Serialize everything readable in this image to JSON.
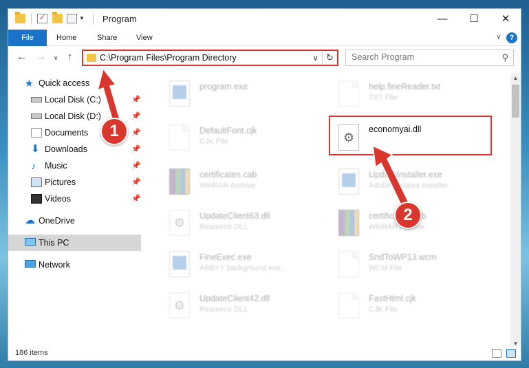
{
  "window": {
    "title": "Program",
    "minimize_glyph": "—",
    "maximize_glyph": "☐",
    "close_glyph": "✕"
  },
  "ribbon": {
    "tabs": [
      {
        "label": "File"
      },
      {
        "label": "Home"
      },
      {
        "label": "Share"
      },
      {
        "label": "View"
      }
    ],
    "help_glyph": "?"
  },
  "navigation": {
    "address_path": "C:\\Program Files\\Program Directory",
    "search_placeholder": "Search Program"
  },
  "sidebar": {
    "items": [
      {
        "label": "Quick access",
        "icon": "star-icon"
      },
      {
        "label": "Local Disk (C:)",
        "icon": "drive-icon",
        "pinned": true
      },
      {
        "label": "Local Disk (D:)",
        "icon": "drive-icon",
        "pinned": true
      },
      {
        "label": "Documents",
        "icon": "documents-icon",
        "pinned": true
      },
      {
        "label": "Downloads",
        "icon": "downloads-icon",
        "pinned": true
      },
      {
        "label": "Music",
        "icon": "music-icon",
        "pinned": true
      },
      {
        "label": "Pictures",
        "icon": "pictures-icon",
        "pinned": true
      },
      {
        "label": "Videos",
        "icon": "videos-icon",
        "pinned": true
      },
      {
        "label": "OneDrive",
        "icon": "onedrive-icon"
      },
      {
        "label": "This PC",
        "icon": "this-pc-icon",
        "selected": true
      },
      {
        "label": "Network",
        "icon": "network-icon"
      }
    ]
  },
  "files": [
    {
      "name": "program.exe",
      "type": "",
      "icon": "exe-icon"
    },
    {
      "name": "help.fineReader.txt",
      "type": "TXT File",
      "icon": "document-icon"
    },
    {
      "name": "DefaultFont.cjk",
      "type": "CJK File",
      "icon": "document-icon"
    },
    {
      "name": "economyai.dll",
      "type": "",
      "icon": "dll-gear-icon",
      "highlighted": true
    },
    {
      "name": "certificates.cab",
      "type": "WinRAR Archive",
      "icon": "winrar-icon"
    },
    {
      "name": "UpdateInstaller.exe",
      "type": "Adobe updates installer",
      "icon": "exe-icon"
    },
    {
      "name": "UpdateClient63.dll",
      "type": "Resource DLL",
      "icon": "dll-gear-icon"
    },
    {
      "name": "certificates.cab",
      "type": "WinRAR Archive",
      "icon": "winrar-icon"
    },
    {
      "name": "FineExec.exe",
      "type": "ABBYY background exe...",
      "icon": "exe-icon"
    },
    {
      "name": "SndToWP13.wcm",
      "type": "WCM File",
      "icon": "document-icon"
    },
    {
      "name": "UpdateClient42.dll",
      "type": "Resource DLL",
      "icon": "dll-gear-icon"
    },
    {
      "name": "FastHtml.cjk",
      "type": "CJK File",
      "icon": "document-icon"
    }
  ],
  "status": {
    "item_count": "186 items"
  },
  "annotations": {
    "step1": "1",
    "step2": "2",
    "color": "#d9362d"
  },
  "colors": {
    "accent": "#1a73c8",
    "highlight": "#d9362d"
  }
}
